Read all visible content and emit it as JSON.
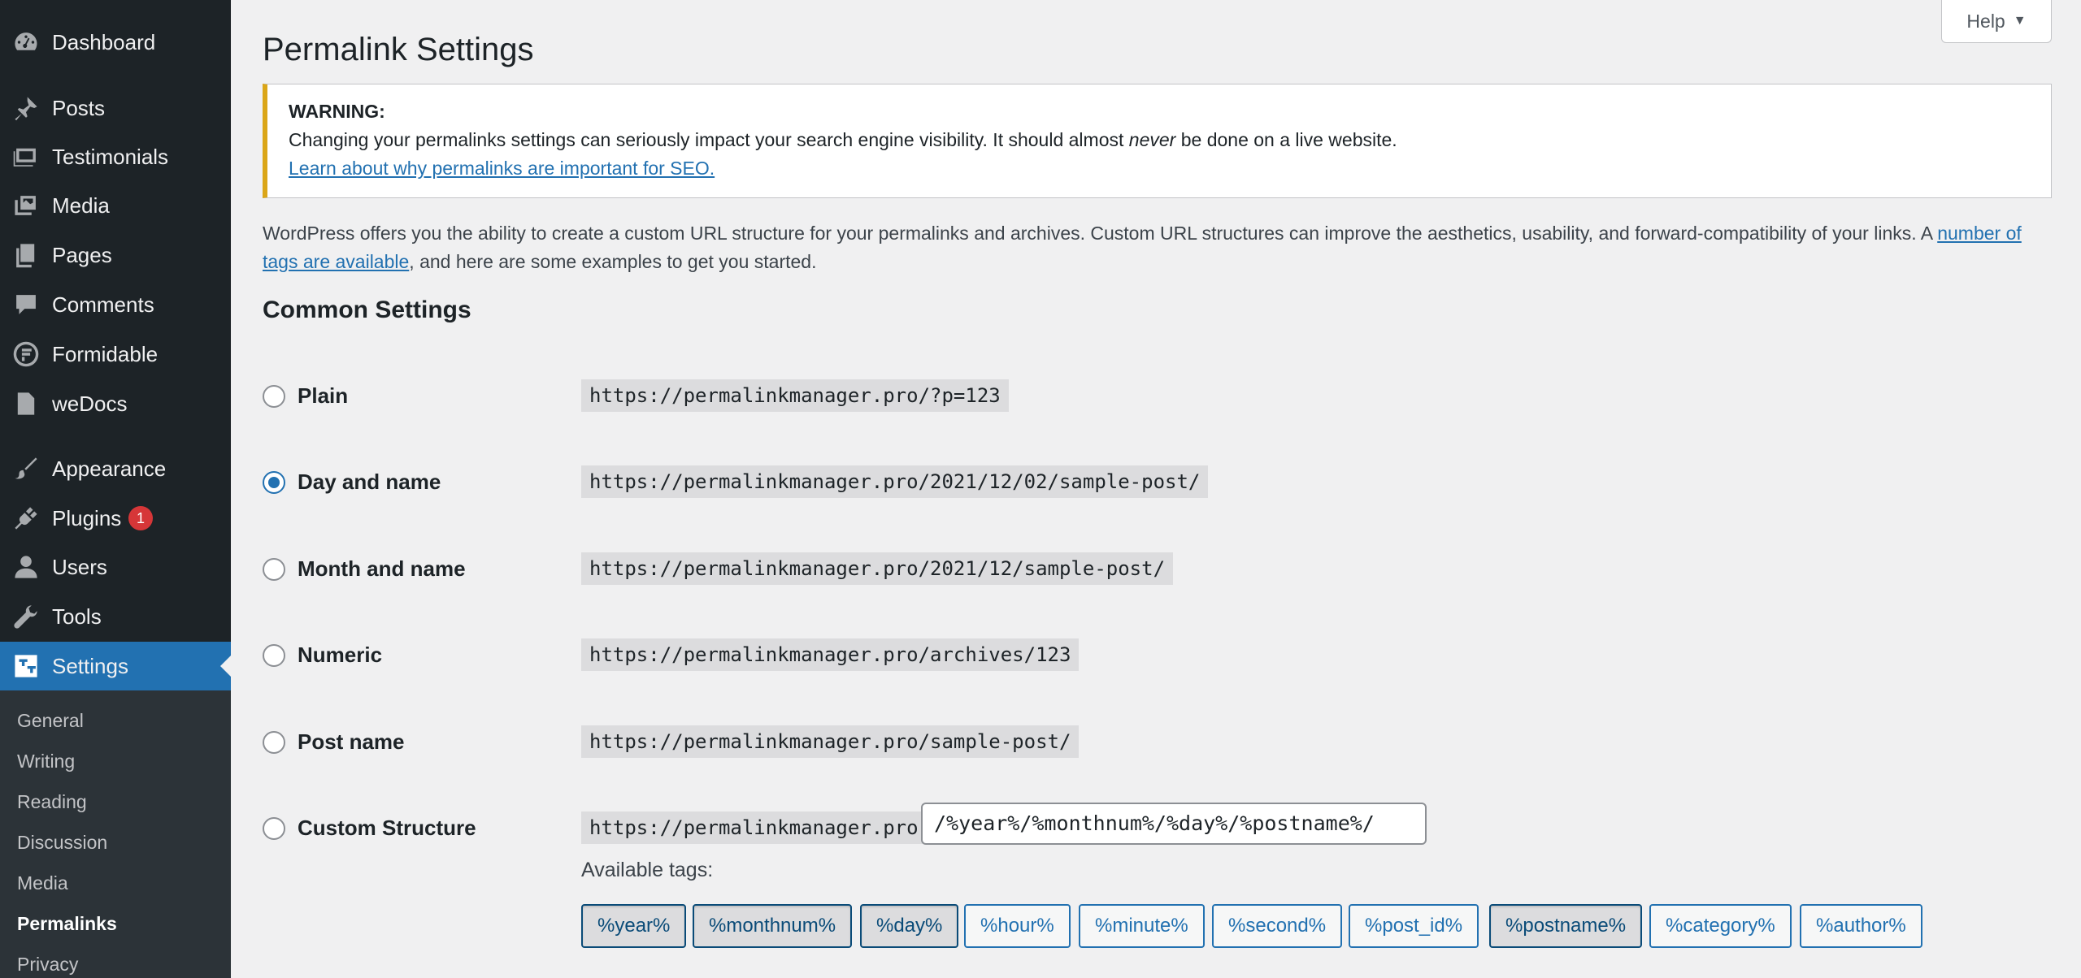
{
  "sidebar": {
    "items": [
      {
        "label": "Dashboard",
        "icon": "dashboard-icon"
      },
      {
        "label": "Posts",
        "icon": "pin-icon"
      },
      {
        "label": "Testimonials",
        "icon": "gallery-icon"
      },
      {
        "label": "Media",
        "icon": "media-icon"
      },
      {
        "label": "Pages",
        "icon": "pages-icon"
      },
      {
        "label": "Comments",
        "icon": "comment-icon"
      },
      {
        "label": "Formidable",
        "icon": "formidable-icon"
      },
      {
        "label": "weDocs",
        "icon": "document-icon"
      },
      {
        "label": "Appearance",
        "icon": "brush-icon"
      },
      {
        "label": "Plugins",
        "icon": "plug-icon",
        "badge": "1"
      },
      {
        "label": "Users",
        "icon": "user-icon"
      },
      {
        "label": "Tools",
        "icon": "wrench-icon"
      },
      {
        "label": "Settings",
        "icon": "settings-icon",
        "current": true
      }
    ],
    "submenu": [
      {
        "label": "General"
      },
      {
        "label": "Writing"
      },
      {
        "label": "Reading"
      },
      {
        "label": "Discussion"
      },
      {
        "label": "Media"
      },
      {
        "label": "Permalinks",
        "current": true
      },
      {
        "label": "Privacy"
      }
    ]
  },
  "help_tab": {
    "label": "Help",
    "caret": "▼"
  },
  "page_title": "Permalink Settings",
  "warning": {
    "title": "WARNING:",
    "text_before": "Changing your permalinks settings can seriously impact your search engine visibility. It should almost ",
    "text_em": "never",
    "text_after": " be done on a live website.",
    "link": "Learn about why permalinks are important for SEO."
  },
  "intro": {
    "text_before": "WordPress offers you the ability to create a custom URL structure for your permalinks and archives. Custom URL structures can improve the aesthetics, usability, and forward-compatibility of your links. A ",
    "link": "number of tags are available",
    "text_after": ", and here are some examples to get you started."
  },
  "section_title": "Common Settings",
  "options": [
    {
      "label": "Plain",
      "example": "https://permalinkmanager.pro/?p=123",
      "checked": false
    },
    {
      "label": "Day and name",
      "example": "https://permalinkmanager.pro/2021/12/02/sample-post/",
      "checked": true
    },
    {
      "label": "Month and name",
      "example": "https://permalinkmanager.pro/2021/12/sample-post/",
      "checked": false
    },
    {
      "label": "Numeric",
      "example": "https://permalinkmanager.pro/archives/123",
      "checked": false
    },
    {
      "label": "Post name",
      "example": "https://permalinkmanager.pro/sample-post/",
      "checked": false
    },
    {
      "label": "Custom Structure",
      "example": "https://permalinkmanager.pro",
      "checked": false
    }
  ],
  "custom_structure_value": "/%year%/%monthnum%/%day%/%postname%/",
  "available_tags_label": "Available tags:",
  "tags": [
    {
      "label": "%year%",
      "active": true
    },
    {
      "label": "%monthnum%",
      "active": true
    },
    {
      "label": "%day%",
      "active": true
    },
    {
      "label": "%hour%",
      "active": false
    },
    {
      "label": "%minute%",
      "active": false
    },
    {
      "label": "%second%",
      "active": false
    },
    {
      "label": "%post_id%",
      "active": false
    },
    {
      "label": "%postname%",
      "active": true
    },
    {
      "label": "%category%",
      "active": false
    },
    {
      "label": "%author%",
      "active": false
    }
  ],
  "colors": {
    "accent": "#2271b1",
    "sidebar": "#1d2327",
    "warning_border": "#dba617",
    "badge": "#d63638"
  }
}
